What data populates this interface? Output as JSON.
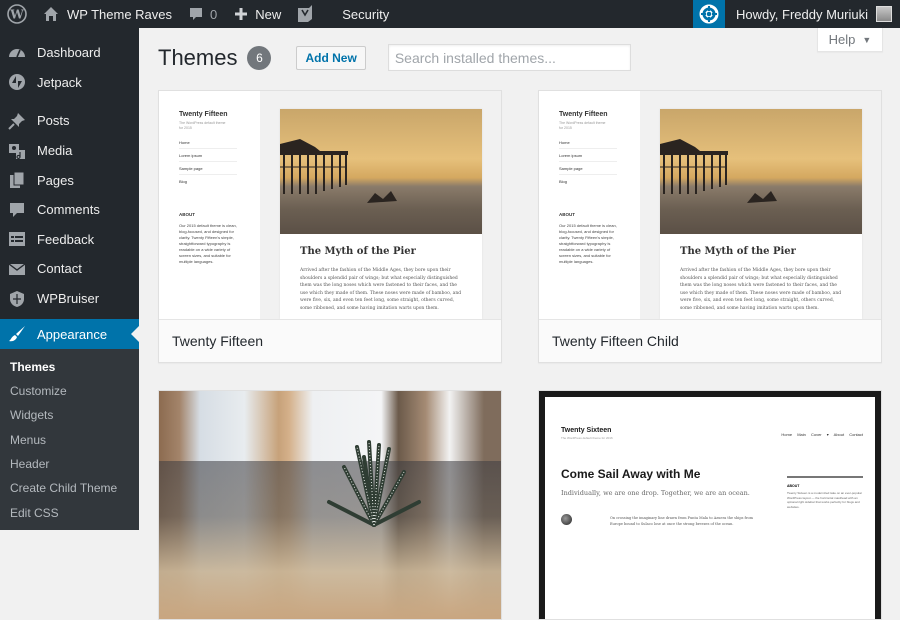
{
  "adminbar": {
    "site_name": "WP Theme Raves",
    "comments_count": "0",
    "new_label": "New",
    "security_label": "Security",
    "greeting": "Howdy, Freddy Muriuki"
  },
  "sidebar": {
    "items": [
      {
        "label": "Dashboard",
        "icon": "dashboard-icon"
      },
      {
        "label": "Jetpack",
        "icon": "jetpack-icon"
      },
      {
        "label": "Posts",
        "icon": "pin-icon"
      },
      {
        "label": "Media",
        "icon": "media-icon"
      },
      {
        "label": "Pages",
        "icon": "pages-icon"
      },
      {
        "label": "Comments",
        "icon": "comment-icon"
      },
      {
        "label": "Feedback",
        "icon": "feedback-icon"
      },
      {
        "label": "Contact",
        "icon": "envelope-icon"
      },
      {
        "label": "WPBruiser",
        "icon": "shield-icon"
      },
      {
        "label": "Appearance",
        "icon": "paintbrush-icon"
      }
    ],
    "submenu": [
      "Themes",
      "Customize",
      "Widgets",
      "Menus",
      "Header",
      "Create Child Theme",
      "Edit CSS"
    ]
  },
  "header": {
    "title": "Themes",
    "count": "6",
    "add_new": "Add New",
    "search_placeholder": "Search installed themes...",
    "help": "Help"
  },
  "themes": [
    {
      "name": "Twenty Fifteen",
      "preview": {
        "site_title": "Twenty Fifteen",
        "tagline": "The WordPress default theme for 2015",
        "menu": [
          "Home",
          "Lorem ipsum",
          "Sample page",
          "Blog"
        ],
        "about_heading": "ABOUT",
        "about_text": "Our 2015 default theme is clean, blog-focused, and designed for clarity. Twenty Fifteen's simple, straightforward typography is readable on a wide variety of screen sizes, and suitable for multiple languages.",
        "post_title": "The Myth of the Pier",
        "post_text": "Arrived after the fashion of the Middle Ages, they bore upon their shoulders a splendid pair of wings; but what especially distinguished them was the long noses which were fastened to their faces, and the use which they made of them. These noses were made of bamboo, and were five, six, and even ten feet long, some straight, others curved, some ribboned, and some having imitation warts upon them."
      }
    },
    {
      "name": "Twenty Fifteen Child",
      "preview": {
        "site_title": "Twenty Fifteen",
        "tagline": "The WordPress default theme for 2015",
        "menu": [
          "Home",
          "Lorem ipsum",
          "Sample page",
          "Blog"
        ],
        "about_heading": "ABOUT",
        "about_text": "Our 2015 default theme is clean, blog-focused, and designed for clarity. Twenty Fifteen's simple, straightforward typography is readable on a wide variety of screen sizes, and suitable for multiple languages.",
        "post_title": "The Myth of the Pier",
        "post_text": "Arrived after the fashion of the Middle Ages, they bore upon their shoulders a splendid pair of wings; but what especially distinguished them was the long noses which were fastened to their faces, and the use which they made of them. These noses were made of bamboo, and were five, six, and even ten feet long, some straight, others curved, some ribboned, and some having imitation warts upon them."
      }
    },
    {
      "name": "",
      "preview": {}
    },
    {
      "name": "",
      "preview": {
        "site_title": "Twenty Sixteen",
        "tagline": "The WordPress default theme for 2016",
        "nav": "Home  Main Cover ▾  About  Contact",
        "heading": "Come Sail Away with Me",
        "subheading": "Individually, we are one drop. Together, we are an ocean.",
        "sidebar_title": "ABOUT",
        "sidebar_text": "Twenty Sixteen is a modernized take on an ever-popular WordPress layout — the horizontal masthead with an optional right sidebar that works perfectly for blogs and websites.",
        "para": "On crossing the imaginary line drawn from Punta Mala to Azuera the ships from Europe bound to Sulaco lose at once the strong breezes of the ocean."
      }
    }
  ]
}
